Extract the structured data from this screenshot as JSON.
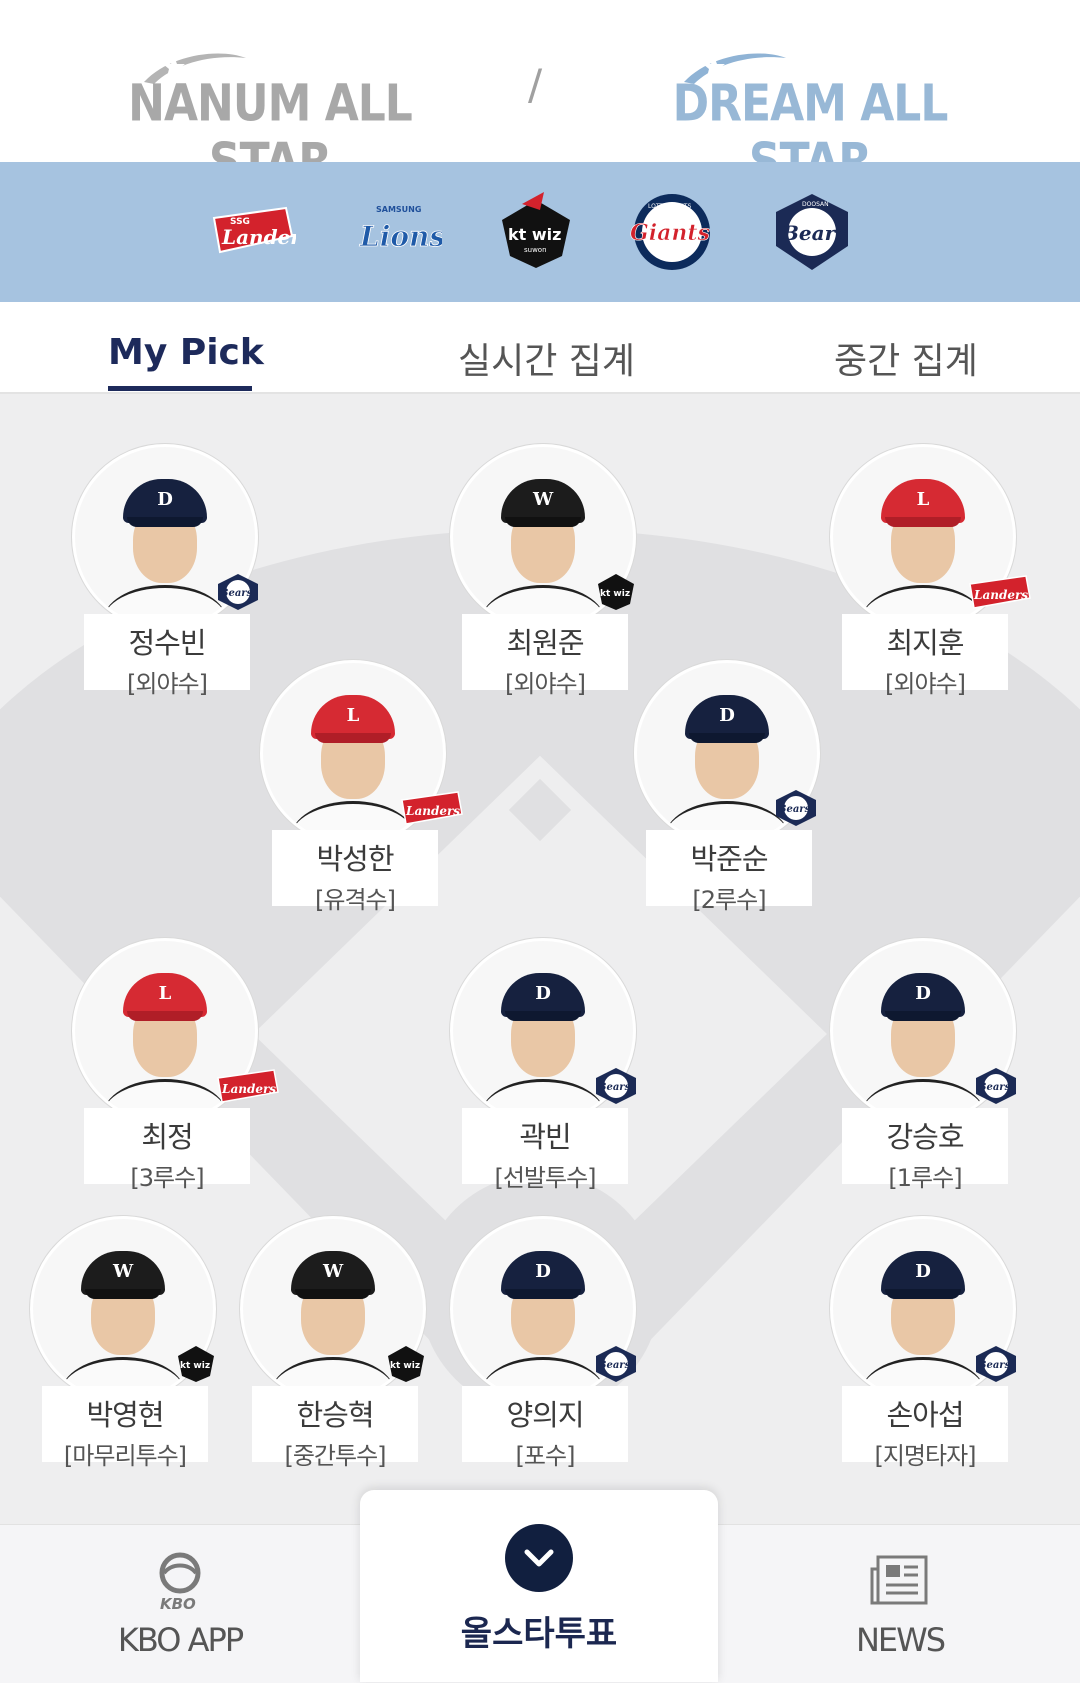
{
  "header": {
    "left_league": "NANUM ALL STAR",
    "separator": "/",
    "right_league": "DREAM ALL STAR"
  },
  "teams": [
    {
      "name": "Landers",
      "icon": "landers-logo"
    },
    {
      "name": "Lions",
      "icon": "lions-logo"
    },
    {
      "name": "kt wiz",
      "icon": "ktwiz-logo"
    },
    {
      "name": "Giants",
      "icon": "giants-logo"
    },
    {
      "name": "Bears",
      "icon": "bears-logo"
    }
  ],
  "tabs": [
    "My Pick",
    "실시간 집계",
    "중간 집계"
  ],
  "players": [
    {
      "name": "정수빈",
      "position": "[외야수]",
      "team": "bears"
    },
    {
      "name": "최원준",
      "position": "[외야수]",
      "team": "ktwiz"
    },
    {
      "name": "최지훈",
      "position": "[외야수]",
      "team": "landers"
    },
    {
      "name": "박성한",
      "position": "[유격수]",
      "team": "landers"
    },
    {
      "name": "박준순",
      "position": "[2루수]",
      "team": "bears"
    },
    {
      "name": "최정",
      "position": "[3루수]",
      "team": "landers"
    },
    {
      "name": "곽빈",
      "position": "[선발투수]",
      "team": "bears"
    },
    {
      "name": "강승호",
      "position": "[1루수]",
      "team": "bears"
    },
    {
      "name": "박영현",
      "position": "[마무리투수]",
      "team": "ktwiz"
    },
    {
      "name": "한승혁",
      "position": "[중간투수]",
      "team": "ktwiz"
    },
    {
      "name": "양의지",
      "position": "[포수]",
      "team": "bears"
    },
    {
      "name": "손아섭",
      "position": "[지명타자]",
      "team": "bears"
    }
  ],
  "badge_text": {
    "bears": "Bears",
    "ktwiz": "kt wiz",
    "landers": "Landers"
  },
  "logo_text": {
    "landers_small": "SSG",
    "landers": "Landers",
    "lions_small": "SAMSUNG",
    "lions": "Lions",
    "ktwiz": "kt wiz",
    "ktwiz_small": "suwon",
    "giants_small": "LOTTE GIANTS",
    "giants": "Giants",
    "bears_small": "DOOSAN",
    "bears": "Bears"
  },
  "nav": {
    "left_label": "KBO APP",
    "left_icon_text": "KBO",
    "center_label": "올스타투표",
    "right_label": "NEWS"
  },
  "colors": {
    "navy": "#1d2a5b",
    "strip": "#a6c3e0",
    "field": "#eeeeef"
  }
}
